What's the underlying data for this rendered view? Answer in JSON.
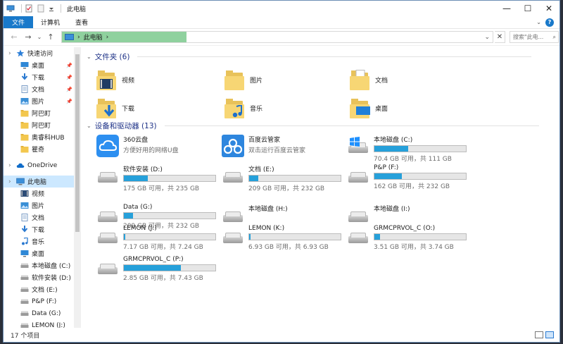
{
  "window": {
    "title": "此电脑",
    "minimize_glyph": "—",
    "maximize_glyph": "☐",
    "close_glyph": "✕"
  },
  "ribbon": {
    "tabs": [
      {
        "label": "文件",
        "active": true
      },
      {
        "label": "计算机",
        "active": false
      },
      {
        "label": "查看",
        "active": false
      }
    ],
    "help_glyph": "?"
  },
  "address": {
    "path": "此电脑",
    "separator": "›",
    "refresh_glyph": "⟳",
    "dropdown_glyph": "⌄",
    "clear_glyph": "✕",
    "search_placeholder": "搜索\"此电...",
    "progress_fraction": 0.29,
    "progress_color": "#8fd19e"
  },
  "sidebar": {
    "items": [
      {
        "label": "快速访问",
        "icon": "star-icon",
        "pinned": false,
        "level": 0
      },
      {
        "label": "桌面",
        "icon": "desktop-icon",
        "pinned": true,
        "level": 1
      },
      {
        "label": "下载",
        "icon": "download-icon",
        "pinned": true,
        "level": 1
      },
      {
        "label": "文档",
        "icon": "document-icon",
        "pinned": true,
        "level": 1
      },
      {
        "label": "图片",
        "icon": "picture-icon",
        "pinned": true,
        "level": 1
      },
      {
        "label": "阿巴町",
        "icon": "folder-icon",
        "pinned": false,
        "level": 1
      },
      {
        "label": "阿巴町",
        "icon": "folder-icon",
        "pinned": false,
        "level": 1
      },
      {
        "label": "奥睿科HUB",
        "icon": "folder-icon",
        "pinned": false,
        "level": 1
      },
      {
        "label": "瞿奇",
        "icon": "folder-icon",
        "pinned": false,
        "level": 1
      },
      {
        "label": "OneDrive",
        "icon": "cloud-icon",
        "pinned": false,
        "level": 0
      },
      {
        "label": "此电脑",
        "icon": "computer-icon",
        "pinned": false,
        "level": 0,
        "selected": true
      },
      {
        "label": "视频",
        "icon": "video-icon",
        "pinned": false,
        "level": 1
      },
      {
        "label": "图片",
        "icon": "picture-icon",
        "pinned": false,
        "level": 1
      },
      {
        "label": "文档",
        "icon": "document-icon",
        "pinned": false,
        "level": 1
      },
      {
        "label": "下载",
        "icon": "download-icon",
        "pinned": false,
        "level": 1
      },
      {
        "label": "音乐",
        "icon": "music-icon",
        "pinned": false,
        "level": 1
      },
      {
        "label": "桌面",
        "icon": "desktop-icon",
        "pinned": false,
        "level": 1
      },
      {
        "label": "本地磁盘 (C:)",
        "icon": "drive-icon",
        "pinned": false,
        "level": 1
      },
      {
        "label": "软件安装 (D:)",
        "icon": "drive-icon",
        "pinned": false,
        "level": 1
      },
      {
        "label": "文档 (E:)",
        "icon": "drive-icon",
        "pinned": false,
        "level": 1
      },
      {
        "label": "P&P (F:)",
        "icon": "drive-icon",
        "pinned": false,
        "level": 1
      },
      {
        "label": "Data (G:)",
        "icon": "drive-icon",
        "pinned": false,
        "level": 1
      },
      {
        "label": "LEMON (J:)",
        "icon": "drive-icon",
        "pinned": false,
        "level": 1
      }
    ]
  },
  "folders": {
    "header": "文件夹 (6)",
    "items": [
      {
        "label": "视频",
        "icon": "video-folder-icon"
      },
      {
        "label": "图片",
        "icon": "pictures-folder-icon"
      },
      {
        "label": "文档",
        "icon": "documents-folder-icon"
      },
      {
        "label": "下载",
        "icon": "downloads-folder-icon"
      },
      {
        "label": "音乐",
        "icon": "music-folder-icon"
      },
      {
        "label": "桌面",
        "icon": "desktop-folder-icon"
      }
    ]
  },
  "drives": {
    "header": "设备和驱动器 (13)",
    "items": [
      {
        "label": "360云盘",
        "sub": "方便好用的网络U盘",
        "kind": "app",
        "icon": "cloud-drive-icon",
        "color": "#2d8ff0"
      },
      {
        "label": "百度云管家",
        "sub": "双击运行百度云管家",
        "kind": "app",
        "icon": "baidu-cloud-icon",
        "color": "#2e86de"
      },
      {
        "label": "本地磁盘 (C:)",
        "size": "70.4 GB 可用，共 111 GB",
        "used_fraction": 0.37,
        "kind": "drive",
        "icon": "windows-drive-icon"
      },
      {
        "label": "软件安装 (D:)",
        "size": "175 GB 可用，共 235 GB",
        "used_fraction": 0.26,
        "kind": "drive",
        "icon": "hdd-icon"
      },
      {
        "label": "文档 (E:)",
        "size": "209 GB 可用，共 232 GB",
        "used_fraction": 0.1,
        "kind": "drive",
        "icon": "hdd-icon"
      },
      {
        "label": "P&P (F:)",
        "size": "162 GB 可用，共 232 GB",
        "used_fraction": 0.3,
        "kind": "drive",
        "icon": "hdd-icon"
      },
      {
        "label": "Data (G:)",
        "size": "209 GB 可用，共 232 GB",
        "used_fraction": 0.1,
        "kind": "drive",
        "icon": "hdd-icon"
      },
      {
        "label": "本地磁盘 (H:)",
        "kind": "drive-nobar",
        "icon": "hdd-icon"
      },
      {
        "label": "本地磁盘 (I:)",
        "kind": "drive-nobar",
        "icon": "hdd-icon"
      },
      {
        "label": "LEMON (J:)",
        "size": "7.17 GB 可用，共 7.24 GB",
        "used_fraction": 0.01,
        "kind": "drive",
        "icon": "hdd-icon"
      },
      {
        "label": "LEMON (K:)",
        "size": "6.93 GB 可用，共 6.93 GB",
        "used_fraction": 0.0,
        "kind": "drive",
        "icon": "hdd-icon"
      },
      {
        "label": "GRMCPRVOL_C (O:)",
        "size": "3.51 GB 可用，共 3.74 GB",
        "used_fraction": 0.06,
        "kind": "drive",
        "icon": "hdd-icon"
      },
      {
        "label": "GRMCPRVOL_C (P:)",
        "size": "2.85 GB 可用，共 7.43 GB",
        "used_fraction": 0.62,
        "kind": "drive",
        "icon": "hdd-icon"
      }
    ]
  },
  "status": {
    "count": "17 个项目"
  },
  "colors": {
    "accent": "#1979ca",
    "bar_fill": "#26a0da",
    "header_text": "#1e3287",
    "selection": "#cce8ff"
  }
}
